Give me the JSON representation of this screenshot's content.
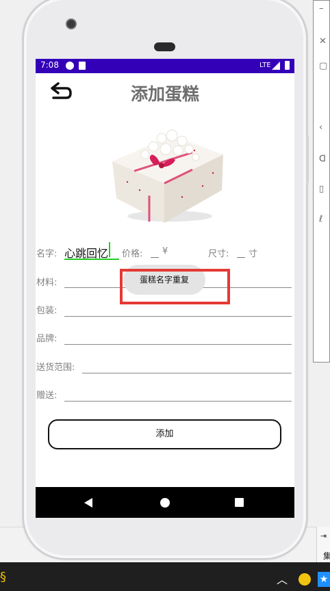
{
  "status_bar": {
    "time": "7:08",
    "network": "LTE"
  },
  "header": {
    "title": "添加蛋糕"
  },
  "form": {
    "name_label": "名字:",
    "name_value": "心跳回忆",
    "price_label": "价格:",
    "price_unit": "¥",
    "size_label": "尺寸:",
    "size_unit": "寸",
    "material_label": "材料:",
    "package_label": "包装:",
    "brand_label": "品牌:",
    "delivery_label": "送货范围:",
    "gift_label": "赠送:"
  },
  "toast": {
    "message": "蛋糕名字重复"
  },
  "actions": {
    "add_label": "添加"
  },
  "nav_bar": {
    "icons": [
      "back-triangle-icon",
      "home-circle-icon",
      "recents-square-icon"
    ]
  },
  "colors": {
    "status_bar": "#3300b8",
    "accent_input": "#22cc22",
    "highlight": "#e53935"
  }
}
